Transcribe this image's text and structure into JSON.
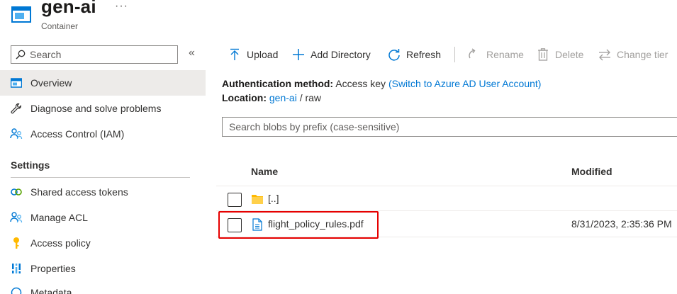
{
  "header": {
    "title": "gen-ai",
    "more": "···",
    "subtitle": "Container",
    "icon": "container-icon"
  },
  "sidebar": {
    "search_placeholder": "Search",
    "collapse": "«",
    "items": [
      {
        "label": "Overview",
        "icon": "overview-icon",
        "active": true
      },
      {
        "label": "Diagnose and solve problems",
        "icon": "wrench-icon"
      },
      {
        "label": "Access Control (IAM)",
        "icon": "people-icon"
      }
    ],
    "settings_header": "Settings",
    "settings_items": [
      {
        "label": "Shared access tokens",
        "icon": "link-icon"
      },
      {
        "label": "Manage ACL",
        "icon": "people-icon"
      },
      {
        "label": "Access policy",
        "icon": "key-icon"
      },
      {
        "label": "Properties",
        "icon": "properties-icon"
      },
      {
        "label": "Metadata",
        "icon": "metadata-icon"
      }
    ]
  },
  "toolbar": {
    "upload": "Upload",
    "add_directory": "Add Directory",
    "refresh": "Refresh",
    "rename": "Rename",
    "delete": "Delete",
    "change_tier": "Change tier"
  },
  "info": {
    "auth_label": "Authentication method:",
    "auth_value": "Access key",
    "auth_link": "(Switch to Azure AD User Account)",
    "location_label": "Location:",
    "location_link": "gen-ai",
    "location_sep": "/",
    "location_path": "raw"
  },
  "prefix_search": {
    "placeholder": "Search blobs by prefix (case-sensitive)"
  },
  "table": {
    "columns": {
      "name": "Name",
      "modified": "Modified"
    },
    "rows": [
      {
        "name": "[..]",
        "modified": "",
        "icon": "folder-icon"
      },
      {
        "name": "flight_policy_rules.pdf",
        "modified": "8/31/2023, 2:35:36 PM",
        "icon": "file-icon"
      }
    ]
  },
  "colors": {
    "accent": "#0078d4",
    "highlight": "#e60000",
    "active_bg": "#edebe9",
    "folder": "#ffb900"
  }
}
